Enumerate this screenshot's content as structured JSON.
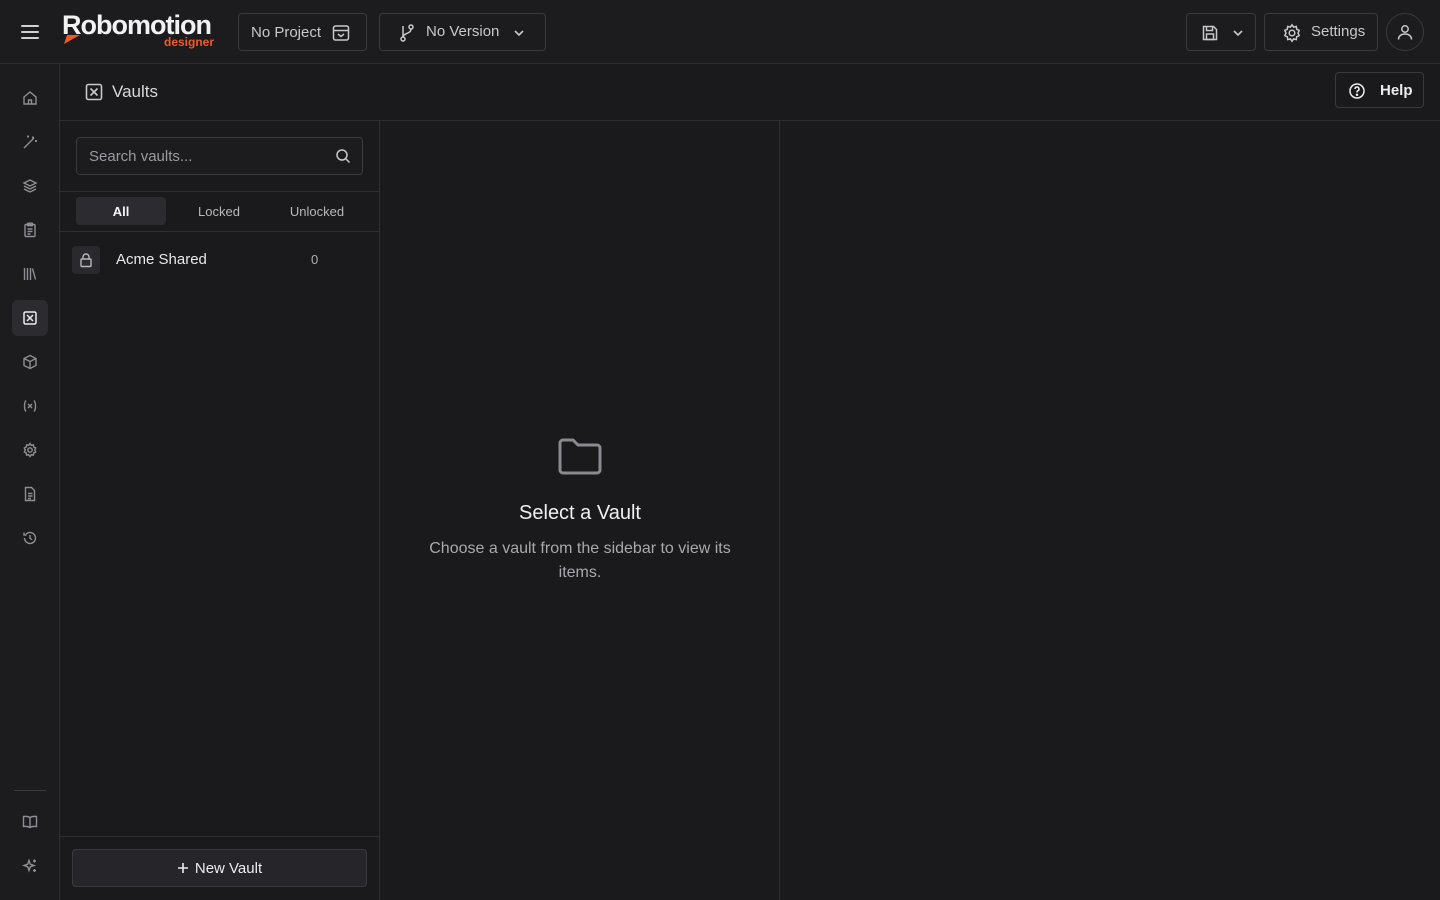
{
  "app": {
    "logo_main": "Robomotion",
    "logo_sub": "designer"
  },
  "topbar": {
    "project_label": "No Project",
    "version_label": "No Version",
    "settings_label": "Settings"
  },
  "header": {
    "title": "Vaults",
    "help_label": "Help"
  },
  "vaults": {
    "search_placeholder": "Search vaults...",
    "filters": [
      "All",
      "Locked",
      "Unlocked"
    ],
    "active_filter": "All",
    "items": [
      {
        "name": "Acme Shared",
        "count": "0",
        "locked": true
      }
    ],
    "new_vault_label": "New Vault"
  },
  "empty_state": {
    "title": "Select a Vault",
    "description": "Choose a vault from the sidebar to view its items."
  },
  "sidebar": {
    "items": [
      {
        "icon": "home-icon"
      },
      {
        "icon": "magic-wand-icon"
      },
      {
        "icon": "layers-icon"
      },
      {
        "icon": "clipboard-icon"
      },
      {
        "icon": "library-icon"
      },
      {
        "icon": "vault-icon",
        "active": true
      },
      {
        "icon": "package-icon"
      },
      {
        "icon": "variable-icon"
      },
      {
        "icon": "gear-icon"
      },
      {
        "icon": "document-icon"
      },
      {
        "icon": "history-icon"
      }
    ],
    "bottom_items": [
      {
        "icon": "book-icon"
      },
      {
        "icon": "sparkle-icon"
      }
    ]
  },
  "colors": {
    "background": "#1a1a1c",
    "accent": "#f0592a",
    "border": "#2f2f33"
  }
}
